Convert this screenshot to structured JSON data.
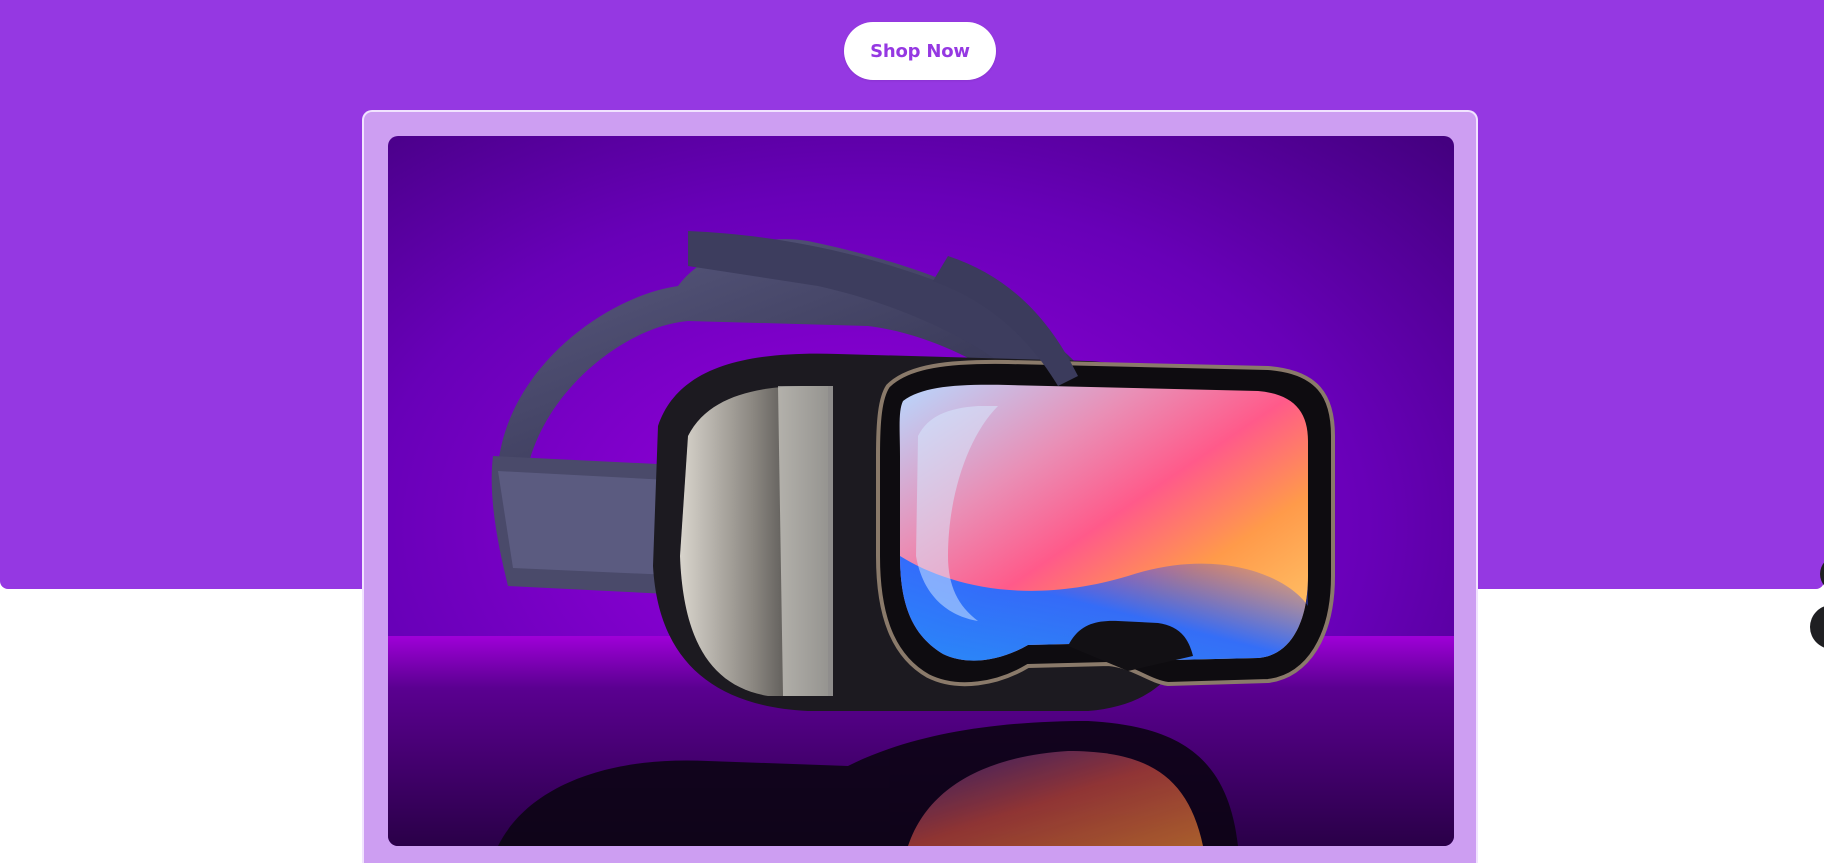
{
  "hero": {
    "background_color": "#9538e2",
    "cta": {
      "label": "Shop Now",
      "text_color": "#9538e2",
      "background": "#ffffff"
    }
  },
  "product_frame": {
    "background_color": "#cd9ef2"
  },
  "product_image": {
    "subject": "vr-headset",
    "backdrop_color": "#7a00c9"
  },
  "floating_controls": [
    {
      "icon": "circle-button"
    },
    {
      "icon": "circle-button"
    }
  ]
}
